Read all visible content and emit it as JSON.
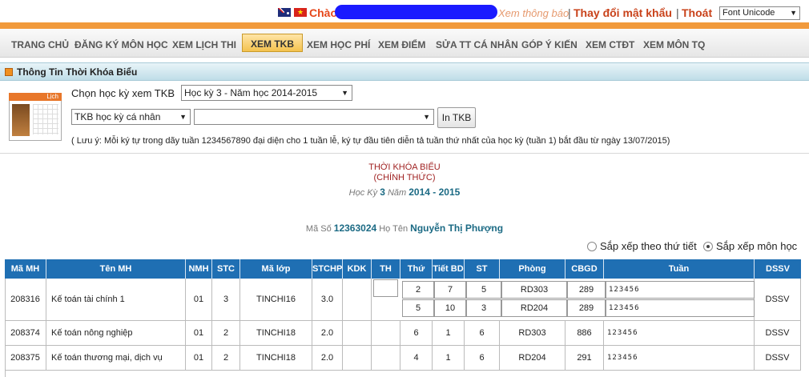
{
  "top": {
    "greeting": "Chào",
    "notice_link": "Xem thông báo",
    "change_password": "Thay đổi mật khẩu",
    "logout": "Thoát",
    "separator": "|",
    "font_select": "Font Unicode"
  },
  "nav": {
    "items": [
      "TRANG CHỦ",
      "ĐĂNG KÝ MÔN HỌC",
      "XEM LỊCH THI",
      "XEM TKB",
      "XEM HỌC PHÍ",
      "XEM ĐIỂM",
      "SỬA TT CÁ NHÂN",
      "GÓP Ý KIẾN",
      "XEM CTĐT",
      "XEM MÔN TQ"
    ],
    "active": "XEM TKB"
  },
  "panel": {
    "title": "Thông Tin Thời Khóa Biểu",
    "calendar_label": "Lịch",
    "choose_term_label": "Chọn học kỳ xem TKB",
    "term_value": "Học kỳ 3 - Năm học 2014-2015",
    "tkb_type": "TKB học kỳ cá nhân",
    "tkb_extra": "",
    "print_button": "In TKB",
    "note": "( Lưu ý: Mỗi ký tự trong dãy tuần 1234567890 đại diện cho 1 tuần lễ, ký tự đầu tiên diễn tả tuần thứ nhất của học kỳ (tuần 1) bắt đầu từ ngày 13/07/2015)"
  },
  "schedule": {
    "title": "THỜI KHÓA BIỂU",
    "subtitle": "(CHÍNH THỨC)",
    "term_prefix": "Học Kỳ",
    "term": "3",
    "year_prefix": "Năm",
    "year": "2014 - 2015",
    "student_id_label": "Mã Số",
    "student_id": "12363024",
    "name_label": "Họ Tên",
    "name": "Nguyễn Thị Phượng",
    "sort_by_day": "Sắp xếp theo thứ tiết",
    "sort_by_subject": "Sắp xếp môn học",
    "sort_selected": "Sắp xếp môn học"
  },
  "table": {
    "headers": [
      "Mã MH",
      "Tên MH",
      "NMH",
      "STC",
      "Mã lớp",
      "STCHP",
      "KDK",
      "TH",
      "Thứ",
      "Tiết BD",
      "ST",
      "Phòng",
      "CBGD",
      "Tuần",
      "DSSV"
    ],
    "rows": [
      {
        "code": "208316",
        "name": "Kế toán tài chính 1",
        "nmh": "01",
        "stc": "3",
        "class": "TINCHI16",
        "stchp": "3.0",
        "kdk": "",
        "th": "",
        "sessions": [
          {
            "day": "2",
            "start": "7",
            "st": "5",
            "room": "RD303",
            "cbgd": "289",
            "weeks": "123456"
          },
          {
            "day": "5",
            "start": "10",
            "st": "3",
            "room": "RD204",
            "cbgd": "289",
            "weeks": "123456"
          }
        ],
        "dssv": "DSSV"
      },
      {
        "code": "208374",
        "name": "Kế toán nông nghiệp",
        "nmh": "01",
        "stc": "2",
        "class": "TINCHI18",
        "stchp": "2.0",
        "kdk": "",
        "th": "",
        "sessions": [
          {
            "day": "6",
            "start": "1",
            "st": "6",
            "room": "RD303",
            "cbgd": "886",
            "weeks": "123456"
          }
        ],
        "dssv": "DSSV"
      },
      {
        "code": "208375",
        "name": "Kế toán thương mại, dịch vụ",
        "nmh": "01",
        "stc": "2",
        "class": "TINCHI18",
        "stchp": "2.0",
        "kdk": "",
        "th": "",
        "sessions": [
          {
            "day": "4",
            "start": "1",
            "st": "6",
            "room": "RD204",
            "cbgd": "291",
            "weeks": "123456"
          }
        ],
        "dssv": "DSSV"
      }
    ]
  },
  "colors": {
    "accent": "#f19a3c",
    "header_blue": "#1f6fb3",
    "link_red": "#c9421a",
    "teal": "#1b6a84"
  }
}
